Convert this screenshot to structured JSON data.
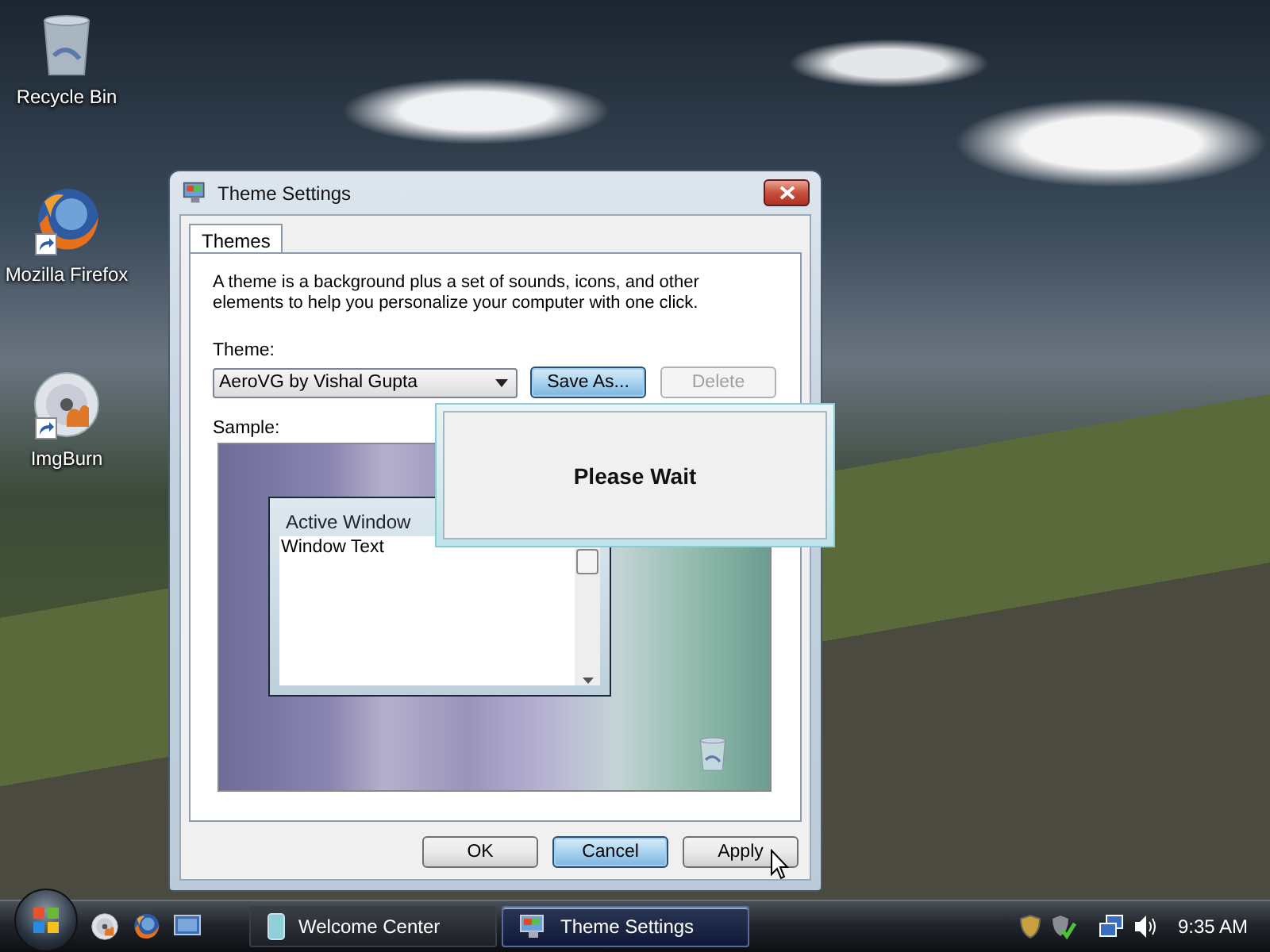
{
  "desktop_icons": [
    {
      "kind": "bin",
      "label": "Recycle Bin",
      "shortcut": false
    },
    {
      "kind": "browser",
      "label": "Mozilla Firefox",
      "shortcut": true
    },
    {
      "kind": "disc",
      "label": "ImgBurn",
      "shortcut": true
    }
  ],
  "dialog": {
    "title": "Theme Settings",
    "tabs": [
      {
        "label": "Themes",
        "selected": true
      }
    ],
    "description": "A theme is a background plus a set of sounds, icons, and other elements to help you personalize your computer with one click.",
    "theme_label": "Theme:",
    "theme_value": "AeroVG by Vishal Gupta",
    "buttons": [
      {
        "label": "Save As...",
        "focused": true,
        "disabled": false
      },
      {
        "label": "Delete",
        "focused": false,
        "disabled": true
      }
    ],
    "sample_label": "Sample:",
    "sample": {
      "window_title": "Active Window",
      "window_text": "Window Text"
    },
    "footer_buttons": [
      {
        "label": "OK",
        "focused": false
      },
      {
        "label": "Cancel",
        "focused": true
      },
      {
        "label": "Apply",
        "focused": false
      }
    ]
  },
  "progress_popup": {
    "message": "Please Wait"
  },
  "taskbar": {
    "quick_launch": [
      {
        "kind": "disc"
      },
      {
        "kind": "browser"
      },
      {
        "kind": "desktop"
      }
    ],
    "tasks": [
      {
        "label": "Welcome Center",
        "kind": "document",
        "selected": false
      },
      {
        "label": "Theme Settings",
        "kind": "display",
        "selected": true
      }
    ],
    "clock": "9:35 AM"
  }
}
